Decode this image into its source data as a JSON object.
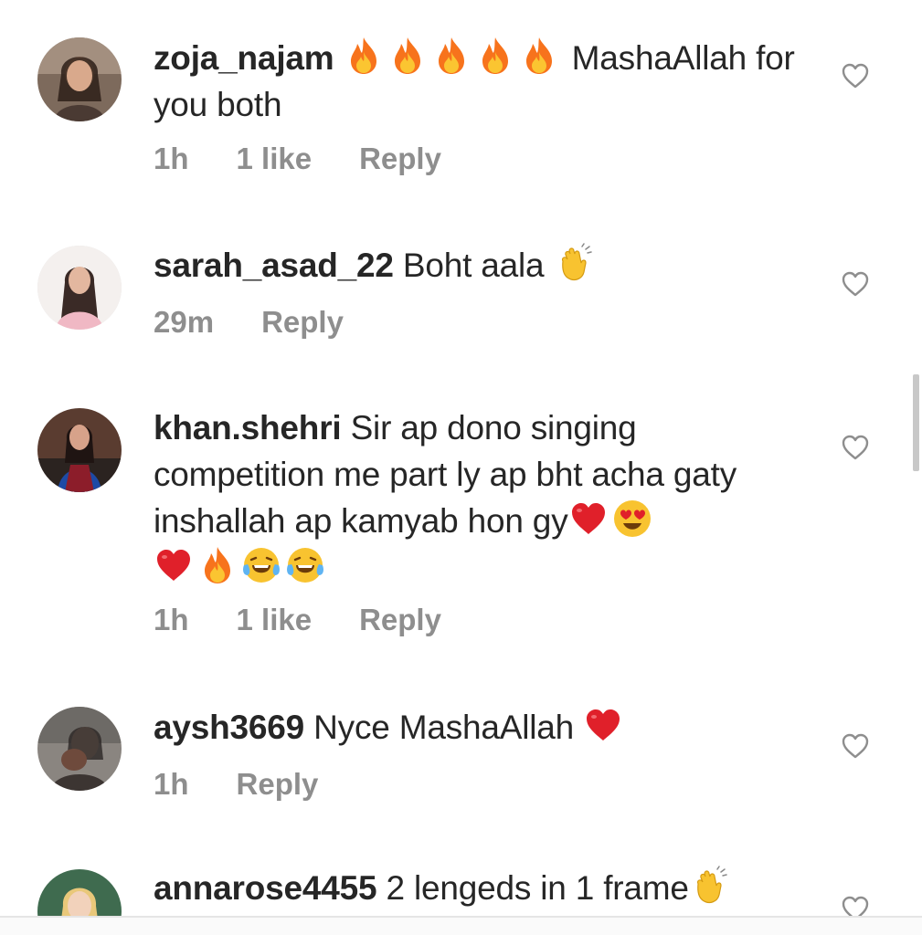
{
  "comments": [
    {
      "username": "zoja_najam",
      "text_after_emoji": "MashaAllah for you both",
      "time": "1h",
      "likes": "1 like",
      "reply": "Reply",
      "avatar_icon": "profile-photo"
    },
    {
      "username": "sarah_asad_22",
      "text": "Boht aala",
      "time": "29m",
      "reply": "Reply",
      "avatar_icon": "profile-photo"
    },
    {
      "username": "khan.shehri",
      "text": "Sir ap dono singing competition me part ly ap bht acha gaty inshallah ap kamyab hon gy",
      "time": "1h",
      "likes": "1 like",
      "reply": "Reply",
      "avatar_icon": "profile-photo"
    },
    {
      "username": "aysh3669",
      "text": "Nyce MashaAllah",
      "time": "1h",
      "reply": "Reply",
      "avatar_icon": "profile-photo"
    },
    {
      "username": "annarose4455",
      "text": "2 lengeds in 1 frame",
      "avatar_icon": "profile-photo"
    }
  ],
  "icons": {
    "like": "heart-outline-icon",
    "fire": "fire-emoji",
    "clap": "clapping-hands-emoji",
    "red_heart": "red-heart-emoji",
    "heart_eyes": "heart-eyes-emoji",
    "tears_of_joy": "tears-of-joy-emoji"
  },
  "colors": {
    "username": "#262626",
    "text": "#262626",
    "meta": "#8e8e8e",
    "heart_outline": "#8e8e8e",
    "emoji_red": "#e0202a",
    "emoji_yellow": "#f8c330"
  }
}
